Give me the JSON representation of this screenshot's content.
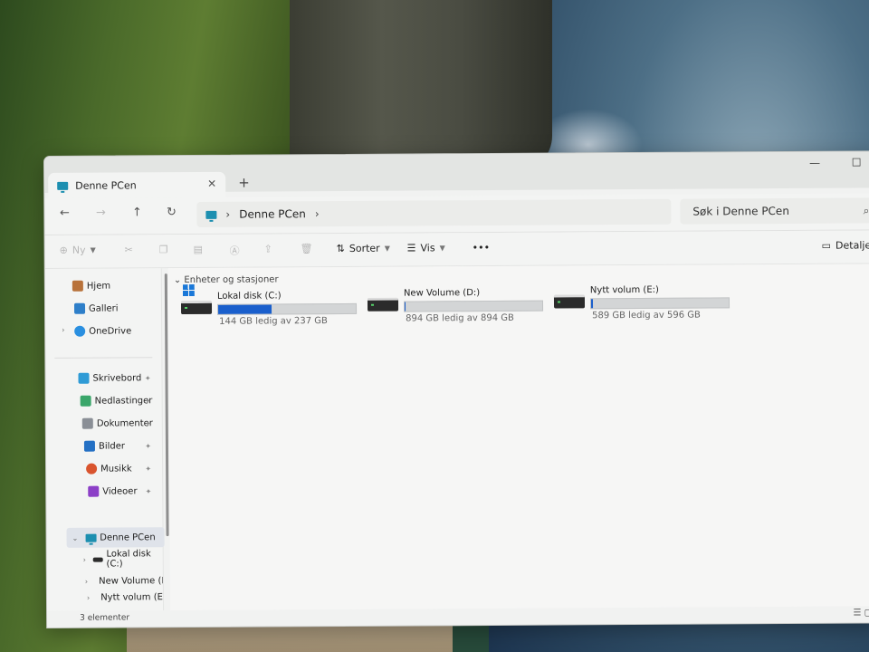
{
  "window": {
    "tab_title": "Denne PCen",
    "tab_close": "✕",
    "new_tab": "+",
    "minimize": "—",
    "maximize": "☐"
  },
  "nav": {
    "back": "←",
    "forward": "→",
    "up": "↑",
    "refresh": "↻",
    "address_crumb": "Denne PCen",
    "crumb_sep": "›",
    "crumb_expand": "›",
    "search_placeholder": "Søk i Denne PCen"
  },
  "toolbar": {
    "new_label": "Ny",
    "sort_label": "Sorter",
    "view_label": "Vis",
    "more_label": "•••",
    "details_label": "Detaljer"
  },
  "sidebar": {
    "top_items": [
      {
        "label": "Hjem",
        "icon": "home-icon"
      },
      {
        "label": "Galleri",
        "icon": "gallery-icon"
      },
      {
        "label": "OneDrive",
        "icon": "cloud-icon"
      }
    ],
    "quick_access": [
      {
        "label": "Skrivebord",
        "icon": "desktop-icon"
      },
      {
        "label": "Nedlastinger",
        "icon": "download-icon"
      },
      {
        "label": "Dokumenter",
        "icon": "document-icon"
      },
      {
        "label": "Bilder",
        "icon": "pictures-icon"
      },
      {
        "label": "Musikk",
        "icon": "music-icon"
      },
      {
        "label": "Videoer",
        "icon": "video-icon"
      }
    ],
    "this_pc": "Denne PCen",
    "drives": [
      "Lokal disk (C:)",
      "New Volume (D:)",
      "Nytt volum (E:)"
    ]
  },
  "content": {
    "section_title": "Enheter og stasjoner",
    "drives": [
      {
        "name": "Lokal disk (C:)",
        "free_text": "144 GB ledig av 237 GB",
        "used_fraction": 0.39
      },
      {
        "name": "New Volume (D:)",
        "free_text": "894 GB ledig av 894 GB",
        "used_fraction": 0.0
      },
      {
        "name": "Nytt volum (E:)",
        "free_text": "589 GB ledig av 596 GB",
        "used_fraction": 0.01
      }
    ]
  },
  "status": {
    "item_count": "3 elementer"
  },
  "colors": {
    "accent": "#1a5fcc"
  }
}
